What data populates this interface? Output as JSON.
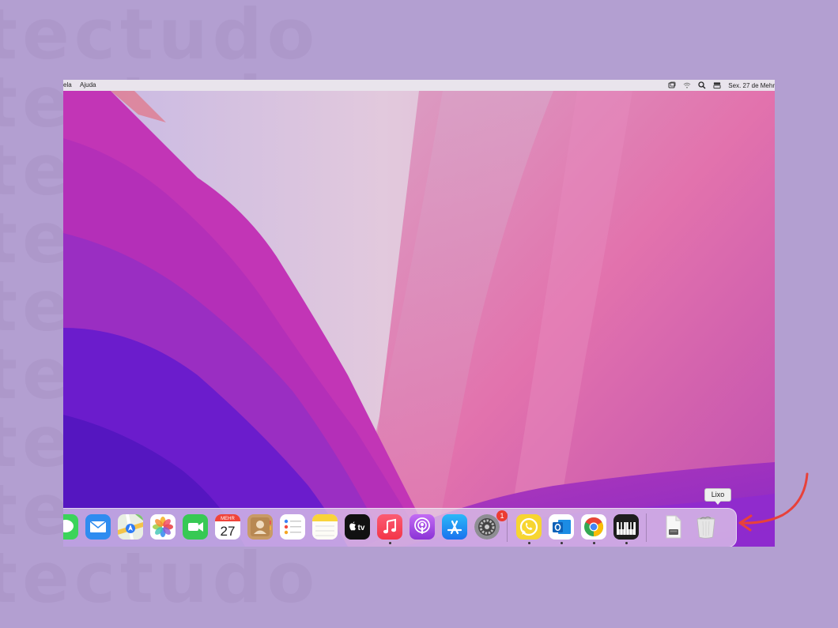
{
  "menubar": {
    "left_items": [
      "ela",
      "Ajuda"
    ],
    "date": "Sex. 27 de Mehr",
    "icons": [
      "control-center-icon",
      "wifi-icon",
      "spotlight-icon",
      "keyboard-icon"
    ]
  },
  "dock": {
    "apps": [
      {
        "name": "Messages",
        "icon": "messages-icon",
        "running": false
      },
      {
        "name": "Mail",
        "icon": "mail-icon",
        "running": false
      },
      {
        "name": "Maps",
        "icon": "maps-icon",
        "running": false
      },
      {
        "name": "Photos",
        "icon": "photos-icon",
        "running": false
      },
      {
        "name": "FaceTime",
        "icon": "facetime-icon",
        "running": false
      },
      {
        "name": "Calendar",
        "icon": "calendar-icon",
        "running": false
      },
      {
        "name": "Contacts",
        "icon": "contacts-icon",
        "running": false
      },
      {
        "name": "Reminders",
        "icon": "reminders-icon",
        "running": false
      },
      {
        "name": "Notes",
        "icon": "notes-icon",
        "running": false
      },
      {
        "name": "TV",
        "icon": "apple-tv-icon",
        "running": false
      },
      {
        "name": "Music",
        "icon": "music-icon",
        "running": true
      },
      {
        "name": "Podcasts",
        "icon": "podcasts-icon",
        "running": false
      },
      {
        "name": "App Store",
        "icon": "app-store-icon",
        "running": false
      },
      {
        "name": "System Preferences",
        "icon": "system-preferences-icon",
        "running": false
      },
      {
        "name": "WhatsApp",
        "icon": "whatsapp-icon",
        "running": true
      },
      {
        "name": "Outlook",
        "icon": "outlook-icon",
        "running": true
      },
      {
        "name": "Chrome",
        "icon": "chrome-icon",
        "running": true
      },
      {
        "name": "Piano",
        "icon": "piano-icon",
        "running": true
      },
      {
        "name": "Document",
        "icon": "document-icon",
        "running": false
      },
      {
        "name": "Lixo",
        "icon": "trash-icon",
        "running": false
      }
    ],
    "calendar": {
      "month": "MEHR",
      "day": "27"
    },
    "tv_label": "tv",
    "system_preferences_badge": "1",
    "trash_tooltip": "Lixo"
  },
  "background": {
    "watermark": "tectudo"
  },
  "colors": {
    "page_background": "#b39fd1",
    "arrow": "#e8413a",
    "badge": "#ec3b32"
  }
}
